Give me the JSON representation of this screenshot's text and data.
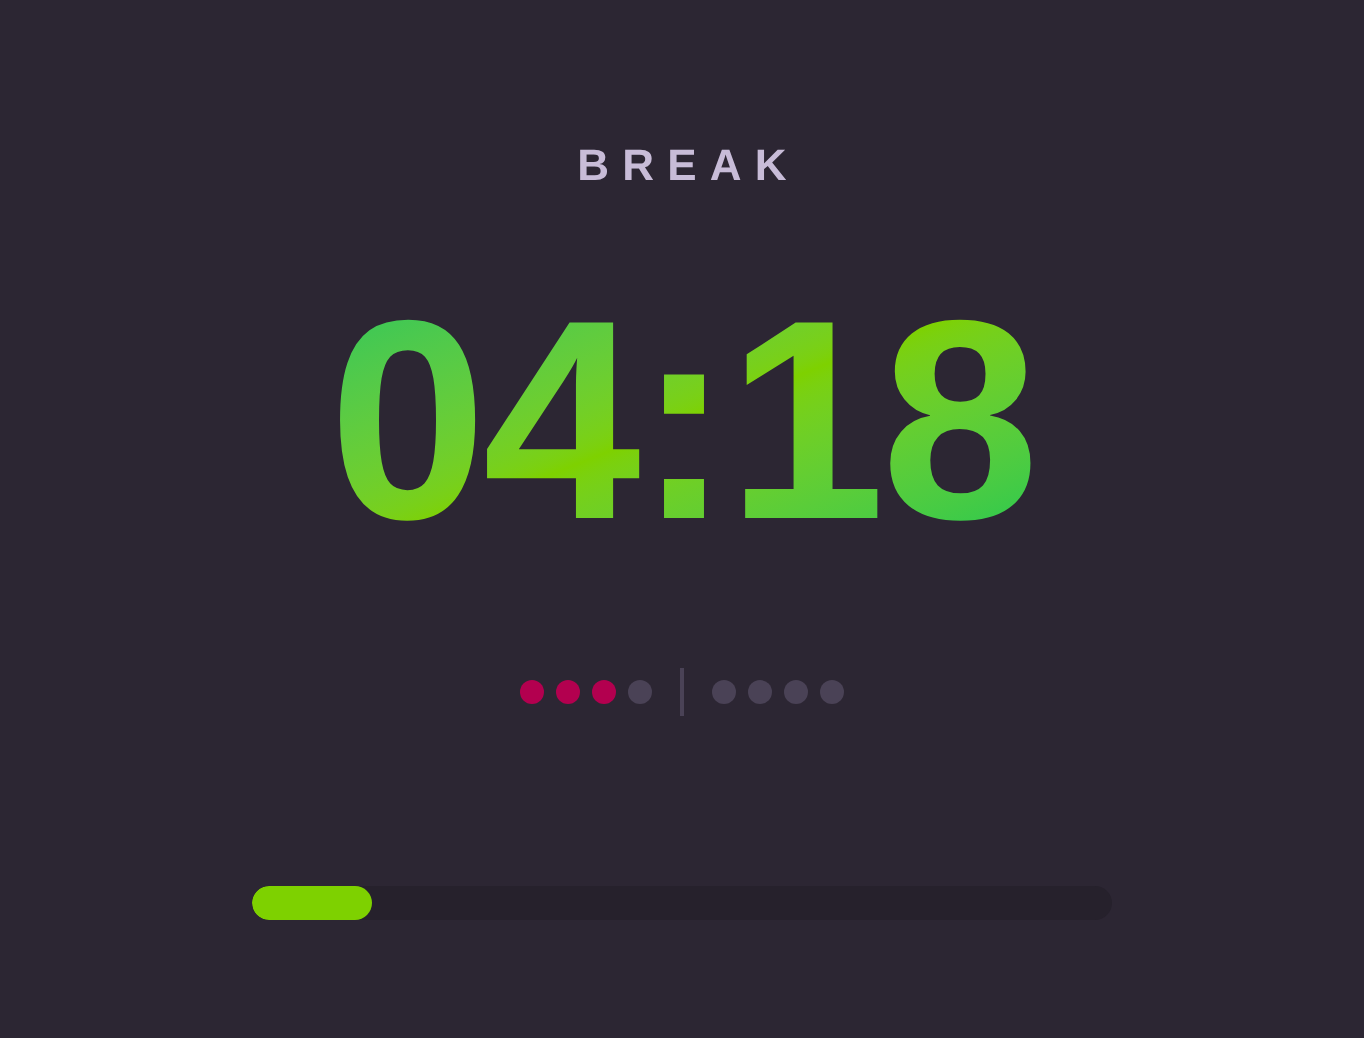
{
  "mode": "BREAK",
  "timer": "04:18",
  "sessions": [
    {
      "dots": [
        {
          "done": true
        },
        {
          "done": true
        },
        {
          "done": true
        },
        {
          "done": false
        }
      ]
    },
    {
      "dots": [
        {
          "done": false
        },
        {
          "done": false
        },
        {
          "done": false
        },
        {
          "done": false
        }
      ]
    }
  ],
  "progress": {
    "level": 0.14
  }
}
